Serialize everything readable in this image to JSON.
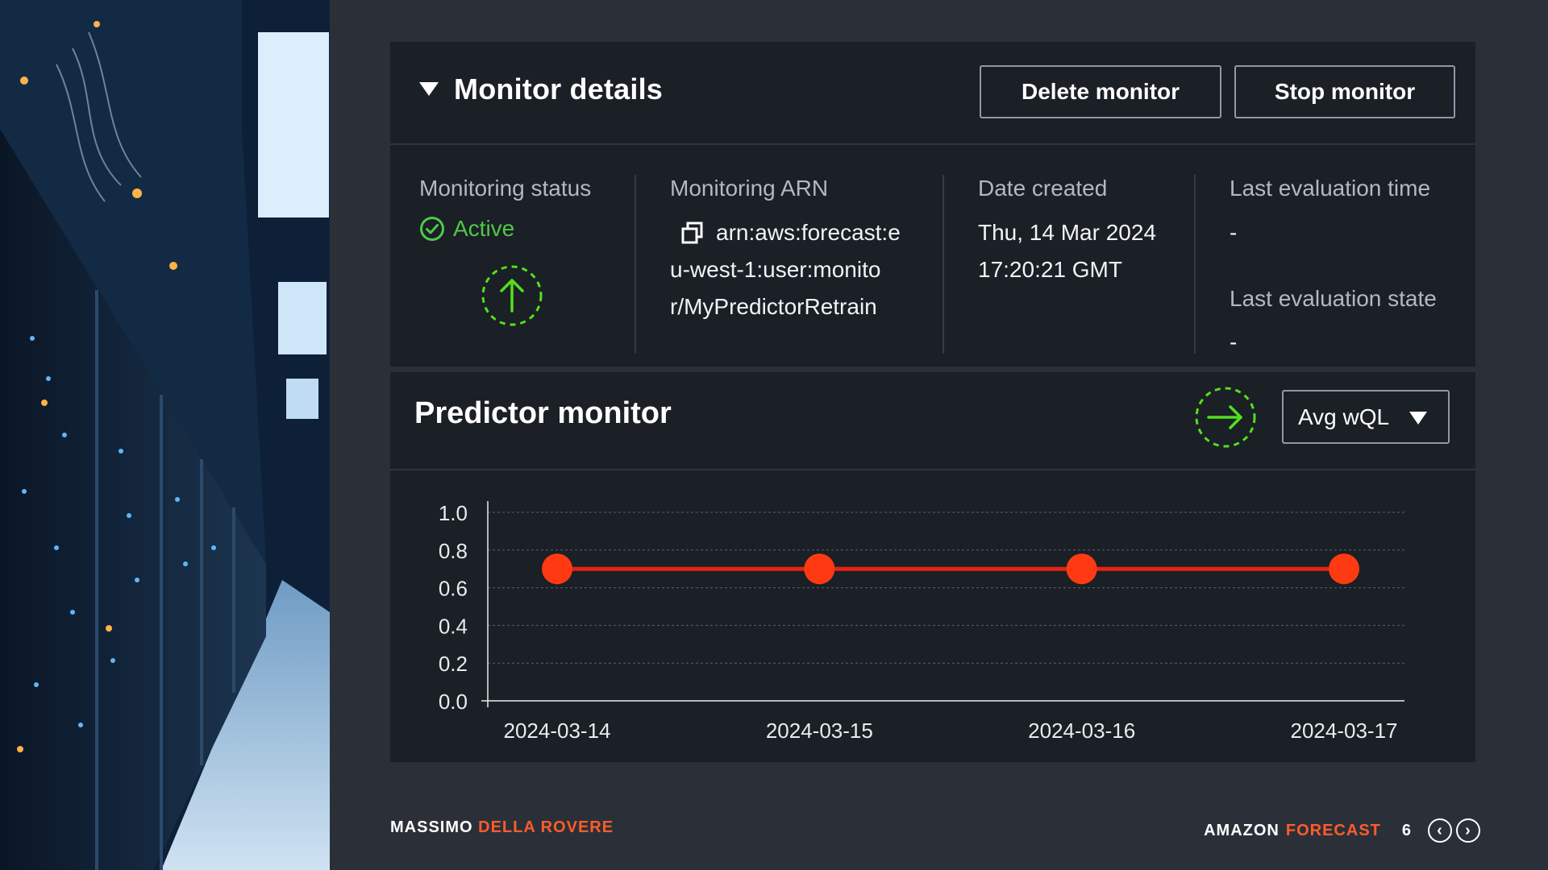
{
  "monitor_details": {
    "title": "Monitor details",
    "buttons": {
      "delete": "Delete monitor",
      "stop": "Stop monitor"
    },
    "status": {
      "label": "Monitoring status",
      "value": "Active",
      "color": "#4fc84a"
    },
    "arn": {
      "label": "Monitoring ARN",
      "line1": "arn:aws:forecast:e",
      "line2": "u-west-1:user:monito",
      "line3": "r/MyPredictorRetrain"
    },
    "date_created": {
      "label": "Date created",
      "line1": "Thu, 14 Mar 2024",
      "line2": "17:20:21 GMT"
    },
    "last_eval_time": {
      "label": "Last evaluation time",
      "value": "-"
    },
    "last_eval_state": {
      "label": "Last evaluation state",
      "value": "-"
    }
  },
  "predictor_monitor": {
    "title": "Predictor monitor",
    "metric_select": "Avg wQL"
  },
  "chart_data": {
    "type": "line",
    "categories": [
      "2024-03-14",
      "2024-03-15",
      "2024-03-16",
      "2024-03-17"
    ],
    "series": [
      {
        "values": [
          0.7,
          0.7,
          0.7,
          0.7
        ],
        "color": "#e8220f",
        "marker_color": "#ff3a12"
      }
    ],
    "ylim": [
      0,
      1.0
    ],
    "yticks": [
      "0.0",
      "0.2",
      "0.4",
      "0.6",
      "0.8",
      "1.0"
    ],
    "grid": true,
    "title": "",
    "xlabel": "",
    "ylabel": ""
  },
  "footer": {
    "author_first": "MASSIMO",
    "author_last": "DELLA ROVERE",
    "product_a": "AMAZON",
    "product_b": "FORECAST",
    "page": "6"
  },
  "icons": {
    "caret": "caret-down-icon",
    "check": "check-circle-icon",
    "copy": "copy-icon",
    "up": "arrow-up-circle-icon",
    "right": "arrow-right-circle-icon",
    "prev": "chevron-left-icon",
    "next": "chevron-right-icon"
  }
}
